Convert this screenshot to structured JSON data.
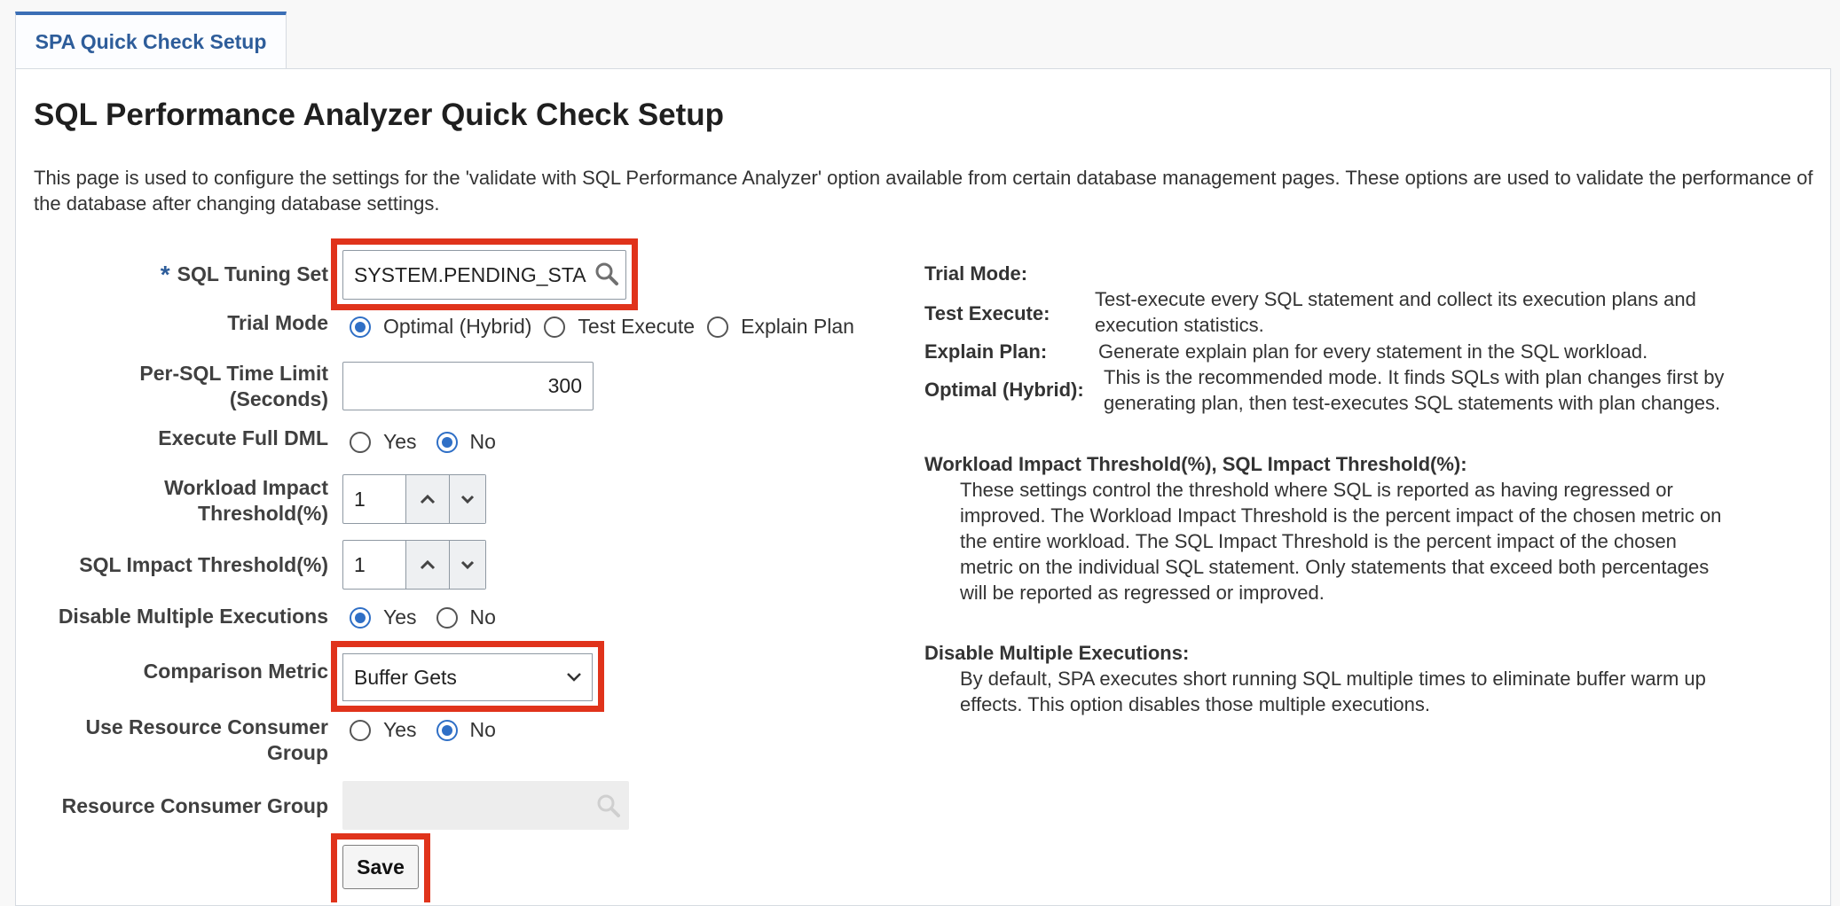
{
  "tab": {
    "label": "SPA Quick Check Setup"
  },
  "page": {
    "title": "SQL Performance Analyzer Quick Check Setup",
    "description": "This page is used to configure the settings for the 'validate with SQL Performance Analyzer' option available from certain database management pages. These options are used to validate the performance of the database after changing database settings."
  },
  "form": {
    "sql_tuning_set": {
      "required_mark": "*",
      "label": "SQL Tuning Set",
      "value": "SYSTEM.PENDING_STA",
      "icon": "search-icon"
    },
    "trial_mode": {
      "label": "Trial Mode",
      "options": [
        {
          "label": "Optimal (Hybrid)",
          "selected": true
        },
        {
          "label": "Test Execute",
          "selected": false
        },
        {
          "label": "Explain Plan",
          "selected": false
        }
      ]
    },
    "time_limit": {
      "label_line1": "Per-SQL Time Limit",
      "label_line2": "(Seconds)",
      "value": "300"
    },
    "execute_full_dml": {
      "label": "Execute Full DML",
      "yes": "Yes",
      "no": "No",
      "selected": "No"
    },
    "workload_impact": {
      "label_line1": "Workload Impact",
      "label_line2": "Threshold(%)",
      "value": "1"
    },
    "sql_impact": {
      "label": "SQL Impact Threshold(%)",
      "value": "1"
    },
    "disable_multiple": {
      "label": "Disable Multiple Executions",
      "yes": "Yes",
      "no": "No",
      "selected": "Yes"
    },
    "comparison_metric": {
      "label": "Comparison Metric",
      "value": "Buffer Gets"
    },
    "use_resource_group": {
      "label_line1": "Use Resource Consumer",
      "label_line2": "Group",
      "yes": "Yes",
      "no": "No",
      "selected": "No"
    },
    "resource_group": {
      "label": "Resource Consumer Group",
      "value": ""
    },
    "save_label": "Save"
  },
  "help": {
    "trial_mode_heading": "Trial Mode:",
    "test_execute_term": "Test Execute:",
    "test_execute_def_line1": "Test-execute every SQL statement and collect its execution plans and",
    "test_execute_def_line2": "execution statistics.",
    "explain_plan_term": "Explain Plan:",
    "explain_plan_def": "Generate explain plan for every statement in the SQL workload.",
    "optimal_term": "Optimal (Hybrid):",
    "optimal_def_line1": "This is the recommended mode. It finds SQLs with plan changes first by",
    "optimal_def_line2": "generating plan, then test-executes SQL statements with plan changes.",
    "threshold_heading": "Workload Impact Threshold(%), SQL Impact Threshold(%):",
    "threshold_lines": [
      "These settings control the threshold where SQL is reported as having regressed or",
      "improved. The Workload Impact Threshold is the percent impact of the chosen metric on",
      "the entire workload. The SQL Impact Threshold is the percent impact of the chosen",
      "metric on the individual SQL statement. Only statements that exceed both percentages",
      "will be reported as regressed or improved."
    ],
    "disable_heading": "Disable Multiple Executions:",
    "disable_lines": [
      "By default, SPA executes short running SQL multiple times to eliminate buffer warm up",
      "effects. This option disables those multiple executions."
    ]
  },
  "colors": {
    "accent": "#2f6fc6",
    "highlight": "#e0331b",
    "tab_border": "#3b6fb6"
  }
}
